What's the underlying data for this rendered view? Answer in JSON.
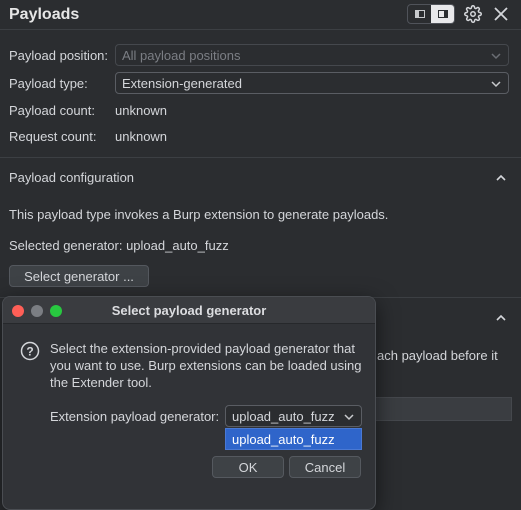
{
  "header": {
    "title": "Payloads"
  },
  "settings": {
    "payload_position": {
      "label": "Payload position:",
      "value": "All payload positions"
    },
    "payload_type": {
      "label": "Payload type:",
      "value": "Extension-generated"
    },
    "payload_count": {
      "label": "Payload count:",
      "value": "unknown"
    },
    "request_count": {
      "label": "Request count:",
      "value": "unknown"
    }
  },
  "payload_configuration": {
    "title": "Payload configuration",
    "description": "This payload type invokes a Burp extension to generate payloads.",
    "selected_generator": "Selected generator: upload_auto_fuzz",
    "select_button": "Select generator ..."
  },
  "background_section": {
    "truncated_text": "ach payload before it"
  },
  "dialog": {
    "title": "Select payload generator",
    "message": "Select the extension-provided payload generator that you want to use. Burp extensions can be loaded using the Extender tool.",
    "generator_label": "Extension payload generator:",
    "generator_value": "upload_auto_fuzz",
    "options": [
      "upload_auto_fuzz"
    ],
    "ok_label": "OK",
    "cancel_label": "Cancel"
  },
  "colors": {
    "background": "#2b2d30",
    "selection": "#2f65ca",
    "close_light": "#ff5f57",
    "max_light": "#28c840"
  }
}
